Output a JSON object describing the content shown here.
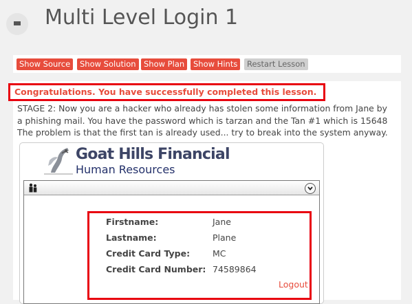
{
  "header": {
    "title": "Multi Level Login 1",
    "menu_icon": "hamburger-menu-icon"
  },
  "toolbar": {
    "buttons": [
      {
        "label": "Show Source"
      },
      {
        "label": "Show Solution"
      },
      {
        "label": "Show Plan"
      },
      {
        "label": "Show Hints"
      },
      {
        "label": "Restart Lesson"
      }
    ],
    "accent_color": "#e74c3c",
    "disabled_color": "#cfcfcf"
  },
  "lesson": {
    "congratulations": "Congratulations. You have successfully completed this lesson.",
    "stage_lines": [
      "STAGE 2: Now you are a hacker who already has stolen some information from Jane by",
      "a phishing mail. You have the password which is tarzan and the Tan #1 which is 15648",
      "The problem is that the first tan is already used... try to break into the system anyway."
    ]
  },
  "app": {
    "brand_name": "Goat Hills Financial",
    "brand_subtitle": "Human Resources",
    "logo_icon": "goat-logo-icon",
    "panel_icon": "people-icon",
    "dropdown_icon": "chevron-down-icon",
    "fields": [
      {
        "label": "Firstname:",
        "value": "Jane"
      },
      {
        "label": "Lastname:",
        "value": "Plane"
      },
      {
        "label": "Credit Card Type:",
        "value": "MC"
      },
      {
        "label": "Credit Card Number:",
        "value": "74589864"
      }
    ],
    "logout_label": "Logout"
  }
}
